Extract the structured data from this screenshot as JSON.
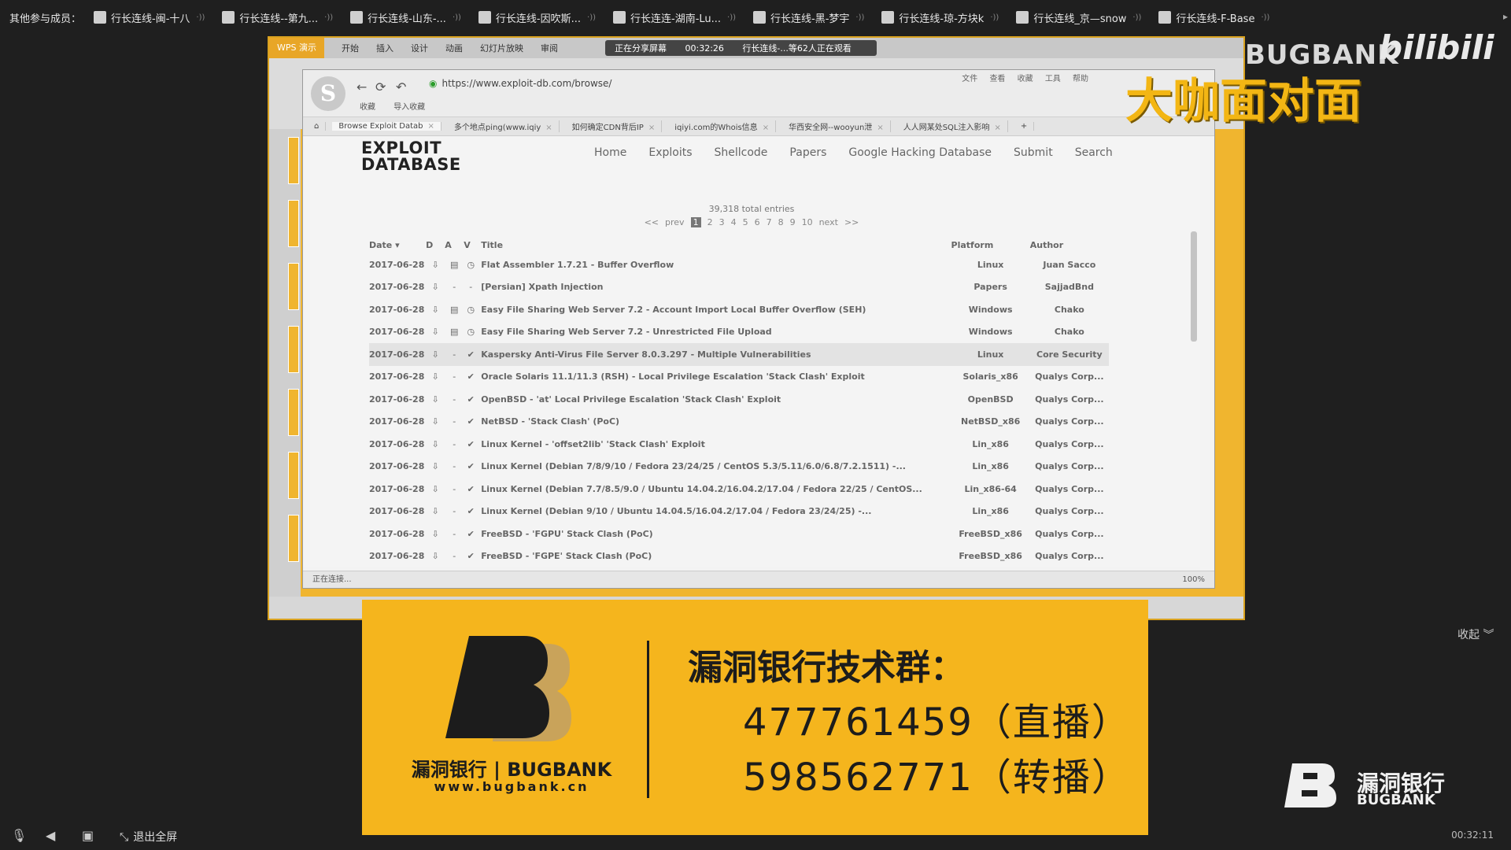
{
  "participants": {
    "label": "其他参与成员：",
    "members": [
      "行长连线-闽-十八",
      "行长连线--第九...",
      "行长连线-山东-...",
      "行长连线-因吹斯...",
      "行长连连-湖南-Lu...",
      "行长连线-黑-梦宇",
      "行长连线-琼-方块k",
      "行长连线_京—snow",
      "行长连线-F-Base"
    ]
  },
  "wps": {
    "title": "WPS 演示",
    "tabs": [
      "开始",
      "插入",
      "设计",
      "动画",
      "幻灯片放映",
      "审阅"
    ]
  },
  "share": {
    "status": "正在分享屏幕",
    "time": "00:32:26",
    "viewers": "行长连线-...等62人正在观看"
  },
  "browser": {
    "url": "https://www.exploit-db.com/browse/",
    "menus": [
      "文件",
      "查看",
      "收藏",
      "工具",
      "帮助"
    ],
    "bookmarks": [
      "收藏",
      "导入收藏"
    ],
    "tabs": [
      "Browse Exploit Datab",
      "多个地点ping(www.iqiy",
      "如何确定CDN背后IP",
      "iqiyi.com的Whois信息",
      "华西安全网--wooyun泄",
      "人人网某处SQL注入影响"
    ],
    "status": "正在连接...",
    "zoom": "100%"
  },
  "edb": {
    "logo_line1": "EXPLOIT",
    "logo_line2": "DATABASE",
    "nav": [
      "Home",
      "Exploits",
      "Shellcode",
      "Papers",
      "Google Hacking Database",
      "Submit",
      "Search"
    ],
    "total_entries": "39,318 total entries",
    "pagination": [
      "<<",
      "prev",
      "1",
      "2",
      "3",
      "4",
      "5",
      "6",
      "7",
      "8",
      "9",
      "10",
      "next",
      ">>"
    ],
    "current_page": "1",
    "columns": [
      "Date ▾",
      "D",
      "A",
      "V",
      "Title",
      "Platform",
      "Author"
    ],
    "rows": [
      {
        "date": "2017-06-28",
        "title": "Flat Assembler 1.7.21 - Buffer Overflow",
        "platform": "Linux",
        "author": "Juan Sacco"
      },
      {
        "date": "2017-06-28",
        "title": "[Persian] Xpath Injection",
        "platform": "Papers",
        "author": "SajjadBnd"
      },
      {
        "date": "2017-06-28",
        "title": "Easy File Sharing Web Server 7.2 - Account Import Local Buffer Overflow (SEH)",
        "platform": "Windows",
        "author": "Chako"
      },
      {
        "date": "2017-06-28",
        "title": "Easy File Sharing Web Server 7.2 - Unrestricted File Upload",
        "platform": "Windows",
        "author": "Chako"
      },
      {
        "date": "2017-06-28",
        "title": "Kaspersky Anti-Virus File Server 8.0.3.297 - Multiple Vulnerabilities",
        "platform": "Linux",
        "author": "Core Security"
      },
      {
        "date": "2017-06-28",
        "title": "Oracle Solaris 11.1/11.3 (RSH) - Local Privilege Escalation 'Stack Clash' Exploit",
        "platform": "Solaris_x86",
        "author": "Qualys Corp..."
      },
      {
        "date": "2017-06-28",
        "title": "OpenBSD - 'at' Local Privilege Escalation 'Stack Clash' Exploit",
        "platform": "OpenBSD",
        "author": "Qualys Corp..."
      },
      {
        "date": "2017-06-28",
        "title": "NetBSD - 'Stack Clash' (PoC)",
        "platform": "NetBSD_x86",
        "author": "Qualys Corp..."
      },
      {
        "date": "2017-06-28",
        "title": "Linux Kernel - 'offset2lib' 'Stack Clash' Exploit",
        "platform": "Lin_x86",
        "author": "Qualys Corp..."
      },
      {
        "date": "2017-06-28",
        "title": "Linux Kernel (Debian 7/8/9/10 / Fedora 23/24/25 / CentOS 5.3/5.11/6.0/6.8/7.2.1511) -...",
        "platform": "Lin_x86",
        "author": "Qualys Corp..."
      },
      {
        "date": "2017-06-28",
        "title": "Linux Kernel (Debian 7.7/8.5/9.0 / Ubuntu 14.04.2/16.04.2/17.04 / Fedora 22/25 / CentOS...",
        "platform": "Lin_x86-64",
        "author": "Qualys Corp..."
      },
      {
        "date": "2017-06-28",
        "title": "Linux Kernel (Debian 9/10 / Ubuntu 14.04.5/16.04.2/17.04 / Fedora 23/24/25) -...",
        "platform": "Lin_x86",
        "author": "Qualys Corp..."
      },
      {
        "date": "2017-06-28",
        "title": "FreeBSD - 'FGPU' Stack Clash (PoC)",
        "platform": "FreeBSD_x86",
        "author": "Qualys Corp..."
      },
      {
        "date": "2017-06-28",
        "title": "FreeBSD - 'FGPE' Stack Clash (PoC)",
        "platform": "FreeBSD_x86",
        "author": "Qualys Corp..."
      }
    ]
  },
  "overlay": {
    "watermark": "BUGBANK",
    "banner": "大咖面对面"
  },
  "ad": {
    "brand": "漏洞银行 | BUGBANK",
    "url": "www.bugbank.cn",
    "heading": "漏洞银行技术群：",
    "line1": "477761459（直播）",
    "line2": "598562771（转播）"
  },
  "corner": {
    "cn": "漏洞银行",
    "en": "BUGBANK"
  },
  "ui": {
    "collapse": "收起",
    "exit_fullscreen": "退出全屏",
    "timer": "00:32:11"
  }
}
